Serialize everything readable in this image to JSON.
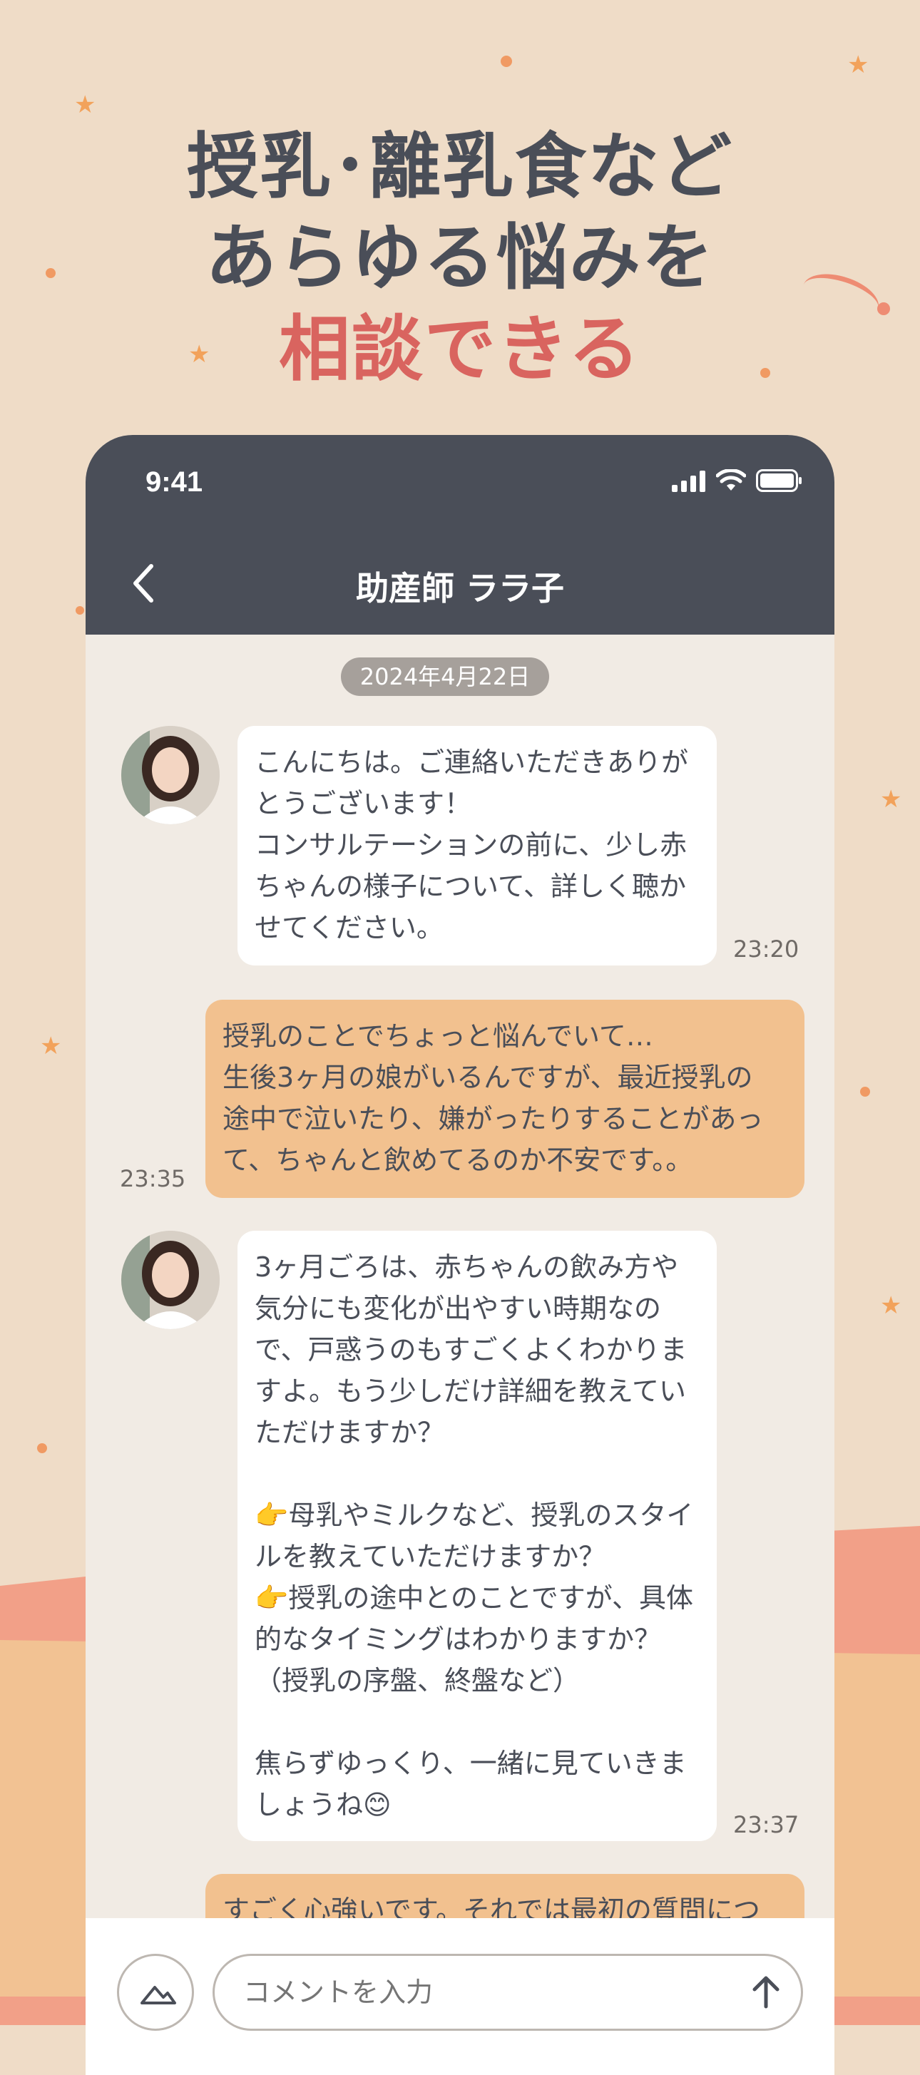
{
  "headline": {
    "line1": "授乳･離乳食など",
    "line2": "あらゆる悩みを",
    "line3": "相談できる"
  },
  "status": {
    "time": "9:41",
    "icons": [
      "signal-icon",
      "wifi-icon",
      "battery-icon"
    ]
  },
  "nav": {
    "back_icon": "chevron-left-icon",
    "title": "助産師 ララ子"
  },
  "chat": {
    "date": "2024年4月22日",
    "messages": [
      {
        "sender": "midwife",
        "text": "こんにちは。ご連絡いただきありが\nとうございます！\nコンサルテーションの前に、少し赤\nちゃんの様子について、詳しく聴か\nせてください。",
        "time": "23:20"
      },
      {
        "sender": "user",
        "text": "授乳のことでちょっと悩んでいて…\n生後3ヶ月の娘がいるんですが、最近授乳の\n途中で泣いたり、嫌がったりすることがあっ\nて、ちゃんと飲めてるのか不安です。。",
        "time": "23:35"
      },
      {
        "sender": "midwife",
        "text": "3ヶ月ごろは、赤ちゃんの飲み方や\n気分にも変化が出やすい時期なの\nで、戸惑うのもすごくよくわかりま\nすよ。もう少しだけ詳細を教えてい\nただけますか？\n\n👉母乳やミルクなど、授乳のスタイ\nルを教えていただけますか？\n👉授乳の途中とのことですが、具体\n的なタイミングはわかりますか？\n（授乳の序盤、終盤など）\n\n焦らずゆっくり、一緒に見ていきま\nしょうね😊",
        "time": "23:37"
      },
      {
        "sender": "user",
        "text": "すごく心強いです。それでは最初の質問につ",
        "time": ""
      }
    ]
  },
  "composer": {
    "placeholder": "コメントを入力",
    "photo_icon": "mountain-image-icon",
    "send_icon": "arrow-up-icon"
  },
  "colors": {
    "background": "#EFDCC7",
    "dark": "#4A4E58",
    "accent": "#D9645F",
    "user_bubble": "#F2C18F",
    "chat_bg": "#F1EBE4"
  }
}
